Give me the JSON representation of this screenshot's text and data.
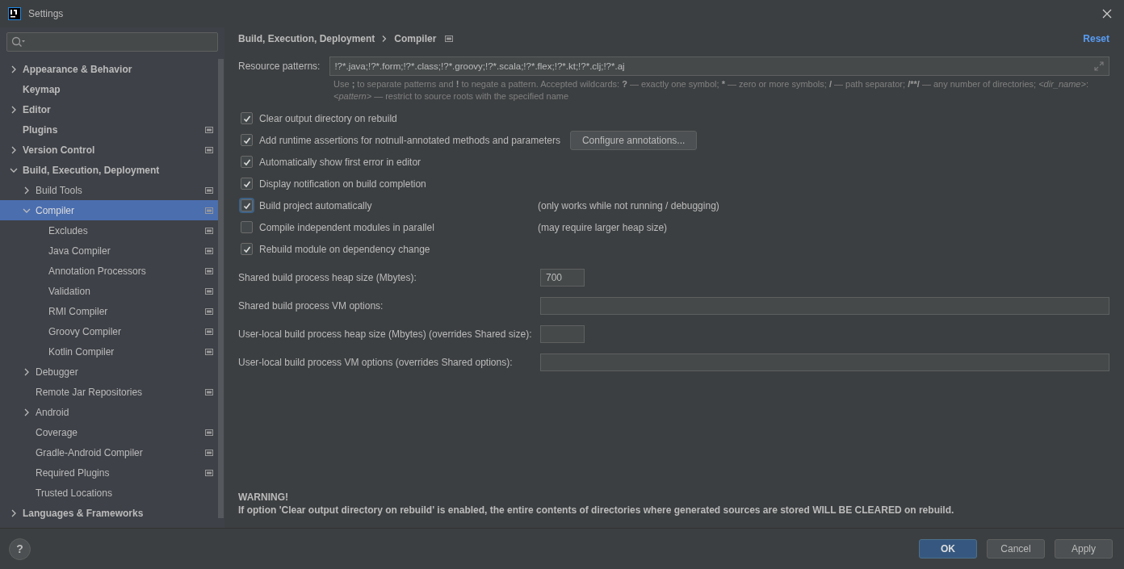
{
  "window": {
    "title": "Settings"
  },
  "sidebar": {
    "items": [
      {
        "label": "Appearance & Behavior",
        "kind": "group",
        "expanded": false,
        "selected": false,
        "scope_icon": false
      },
      {
        "label": "Keymap",
        "kind": "leaf",
        "selected": false,
        "scope_icon": false
      },
      {
        "label": "Editor",
        "kind": "group",
        "expanded": false,
        "selected": false,
        "scope_icon": false
      },
      {
        "label": "Plugins",
        "kind": "leaf",
        "selected": false,
        "scope_icon": true
      },
      {
        "label": "Version Control",
        "kind": "group",
        "expanded": false,
        "selected": false,
        "scope_icon": true
      },
      {
        "label": "Build, Execution, Deployment",
        "kind": "group",
        "expanded": true,
        "selected": false,
        "scope_icon": false,
        "children": [
          {
            "label": "Build Tools",
            "kind": "group",
            "expanded": false,
            "selected": false,
            "scope_icon": true
          },
          {
            "label": "Compiler",
            "kind": "group",
            "expanded": true,
            "selected": true,
            "scope_icon": true,
            "children": [
              {
                "label": "Excludes",
                "kind": "leaf",
                "selected": false,
                "scope_icon": true
              },
              {
                "label": "Java Compiler",
                "kind": "leaf",
                "selected": false,
                "scope_icon": true
              },
              {
                "label": "Annotation Processors",
                "kind": "leaf",
                "selected": false,
                "scope_icon": true
              },
              {
                "label": "Validation",
                "kind": "leaf",
                "selected": false,
                "scope_icon": true
              },
              {
                "label": "RMI Compiler",
                "kind": "leaf",
                "selected": false,
                "scope_icon": true
              },
              {
                "label": "Groovy Compiler",
                "kind": "leaf",
                "selected": false,
                "scope_icon": true
              },
              {
                "label": "Kotlin Compiler",
                "kind": "leaf",
                "selected": false,
                "scope_icon": true
              }
            ]
          },
          {
            "label": "Debugger",
            "kind": "group",
            "expanded": false,
            "selected": false,
            "scope_icon": false
          },
          {
            "label": "Remote Jar Repositories",
            "kind": "leaf",
            "selected": false,
            "scope_icon": true
          },
          {
            "label": "Android",
            "kind": "group",
            "expanded": false,
            "selected": false,
            "scope_icon": false
          },
          {
            "label": "Coverage",
            "kind": "leaf",
            "selected": false,
            "scope_icon": true
          },
          {
            "label": "Gradle-Android Compiler",
            "kind": "leaf",
            "selected": false,
            "scope_icon": true
          },
          {
            "label": "Required Plugins",
            "kind": "leaf",
            "selected": false,
            "scope_icon": true
          },
          {
            "label": "Trusted Locations",
            "kind": "leaf",
            "selected": false,
            "scope_icon": false
          }
        ]
      },
      {
        "label": "Languages & Frameworks",
        "kind": "group",
        "expanded": false,
        "selected": false,
        "scope_icon": false
      }
    ]
  },
  "breadcrumb": [
    "Build, Execution, Deployment",
    "Compiler"
  ],
  "reset": "Reset",
  "resource_patterns": {
    "label": "Resource patterns:",
    "value": "!?*.java;!?*.form;!?*.class;!?*.groovy;!?*.scala;!?*.flex;!?*.kt;!?*.clj;!?*.aj",
    "hint": [
      {
        "text": "Use ",
        "kind": "text"
      },
      {
        "text": ";",
        "kind": "symbol"
      },
      {
        "text": " to separate patterns and ",
        "kind": "text"
      },
      {
        "text": "!",
        "kind": "symbol"
      },
      {
        "text": " to negate a pattern. Accepted wildcards: ",
        "kind": "text"
      },
      {
        "text": "?",
        "kind": "symbol"
      },
      {
        "text": " — exactly one symbol; ",
        "kind": "text"
      },
      {
        "text": "*",
        "kind": "symbol"
      },
      {
        "text": " — zero or more symbols; ",
        "kind": "text"
      },
      {
        "text": "/",
        "kind": "symbol"
      },
      {
        "text": " — path separator; ",
        "kind": "text"
      },
      {
        "text": "/**/",
        "kind": "symbol"
      },
      {
        "text": " — any number of directories; ",
        "kind": "text"
      },
      {
        "text": "<dir_name>",
        "kind": "name"
      },
      {
        "text": ":",
        "kind": "text"
      },
      {
        "text": "<pattern>",
        "kind": "name"
      },
      {
        "text": " — restrict to source roots with the specified name",
        "kind": "text"
      }
    ]
  },
  "options": [
    {
      "label": "Clear output directory on rebuild",
      "checked": true,
      "focused": false
    },
    {
      "label": "Add runtime assertions for notnull-annotated methods and parameters",
      "checked": true,
      "focused": false,
      "button": "Configure annotations..."
    },
    {
      "label": "Automatically show first error in editor",
      "checked": true,
      "focused": false
    },
    {
      "label": "Display notification on build completion",
      "checked": true,
      "focused": false
    },
    {
      "label": "Build project automatically",
      "checked": true,
      "focused": true,
      "note": "(only works while not running / debugging)"
    },
    {
      "label": "Compile independent modules in parallel",
      "checked": false,
      "focused": false,
      "note": "(may require larger heap size)"
    },
    {
      "label": "Rebuild module on dependency change",
      "checked": true,
      "focused": false
    }
  ],
  "fields": [
    {
      "label": "Shared build process heap size (Mbytes):",
      "value": "700",
      "kind": "short"
    },
    {
      "label": "Shared build process VM options:",
      "kind": "long"
    },
    {
      "label": "User-local build process heap size (Mbytes) (overrides Shared size):",
      "kind": "short"
    },
    {
      "label": "User-local build process VM options (overrides Shared options):",
      "kind": "long"
    }
  ],
  "warning": {
    "title": "WARNING!",
    "text": "If option 'Clear output directory on rebuild' is enabled, the entire contents of directories where generated sources are stored WILL BE CLEARED on rebuild."
  },
  "help": "?",
  "buttons": [
    {
      "label": "OK",
      "kind": "primary"
    },
    {
      "label": "Cancel",
      "kind": "normal"
    },
    {
      "label": "Apply",
      "kind": "normal"
    }
  ]
}
